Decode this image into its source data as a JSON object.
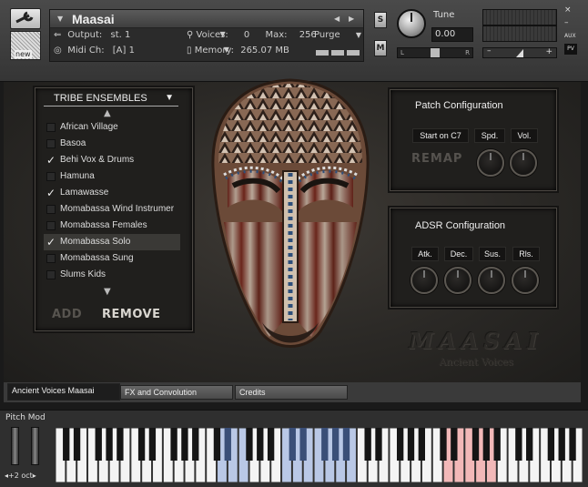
{
  "header": {
    "instrument_name": "Maasai",
    "output_label": "Output:",
    "output_value": "st. 1",
    "midi_label": "Midi Ch:",
    "midi_value": "[A]  1",
    "voices_label": "Voices:",
    "voices_value": "0",
    "max_label": "Max:",
    "max_value": "256",
    "purge_label": "Purge",
    "memory_label": "Memory:",
    "memory_value": "265.07 MB",
    "solo_btn": "S",
    "mute_btn": "M",
    "tune_label": "Tune",
    "tune_value": "0.00",
    "pan_left": "L",
    "pan_right": "R",
    "vol_minus": "–",
    "vol_plus": "+",
    "close": "×",
    "minimize": "–",
    "aux": "AUX",
    "pv": "PV",
    "new_label": "new"
  },
  "tribe": {
    "title": "TRIBE ENSEMBLES",
    "items": [
      {
        "label": "African Village",
        "checked": false
      },
      {
        "label": "Basoa",
        "checked": false
      },
      {
        "label": "Behi Vox & Drums",
        "checked": true
      },
      {
        "label": "Hamuna",
        "checked": false
      },
      {
        "label": "Lamawasse",
        "checked": true
      },
      {
        "label": "Momabassa Wind Instrumer",
        "checked": false
      },
      {
        "label": "Momabassa Females",
        "checked": false
      },
      {
        "label": "Momabassa Solo",
        "checked": true
      },
      {
        "label": "Momabassa Sung",
        "checked": false
      },
      {
        "label": "Slums Kids",
        "checked": false
      }
    ],
    "add": "ADD",
    "remove": "REMOVE",
    "check_glyph": "✓"
  },
  "patch": {
    "title": "Patch Configuration",
    "start_on": "Start on C7",
    "speed": "Spd.",
    "volume": "Vol.",
    "remap": "REMAP"
  },
  "adsr": {
    "title": "ADSR Configuration",
    "attack": "Atk.",
    "decay": "Dec.",
    "sustain": "Sus.",
    "release": "Rls."
  },
  "logo": {
    "title": "MAASAI",
    "subtitle": "Ancient Voices"
  },
  "tabs": [
    "Ancient Voices Maasai",
    "FX and Convolution",
    "Credits"
  ],
  "keyboard": {
    "pitch_mod": "Pitch Mod",
    "octave": "+2 oct",
    "white_key_count": 49,
    "blue_range": [
      [
        15,
        17
      ],
      [
        21,
        27
      ]
    ],
    "red_range": [
      [
        36,
        40
      ]
    ]
  },
  "colors": {
    "key_blue": "#b9c8e6",
    "key_red": "#f2b8b8",
    "remove_text": "#d9d6d0",
    "add_text": "#57544f"
  }
}
